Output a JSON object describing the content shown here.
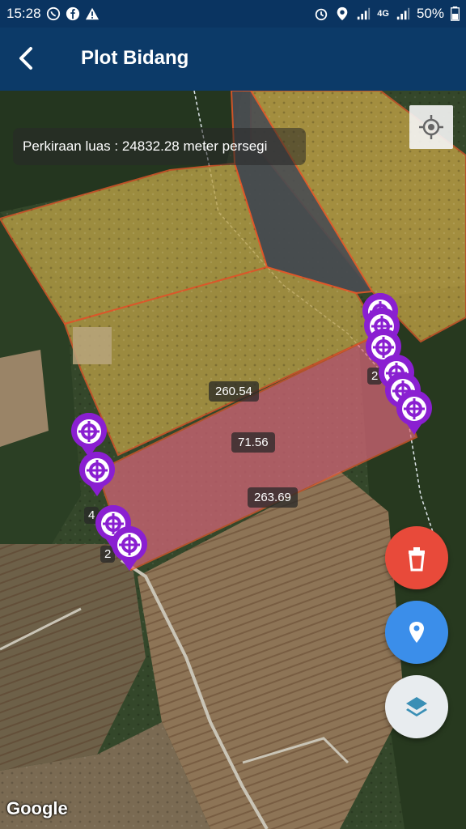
{
  "status_bar": {
    "time": "15:28",
    "network": "4G",
    "battery": "50%",
    "left_icons": [
      "whatsapp-icon",
      "facebook-icon",
      "warning-icon"
    ],
    "right_icons": [
      "alarm-icon",
      "location-icon",
      "signal-icon",
      "signal-icon",
      "battery-icon"
    ]
  },
  "app_bar": {
    "title": "Plot Bidang",
    "back_icon": "arrow-back-icon"
  },
  "map": {
    "area_label": "Perkiraan luas : 24832.28 meter persegi",
    "segment_labels": [
      "260.54",
      "71.56",
      "263.69"
    ],
    "partial_labels": [
      "2",
      "4",
      "2"
    ],
    "google_logo": "Google",
    "plot_fill_color": "#d9667a",
    "parcel_fill_color": "#d4b24a",
    "marker_color": "#8a1fd1"
  },
  "actions": {
    "delete_icon": "trash-icon",
    "delete_color": "#e84a3a",
    "add_point_icon": "map-pin-icon",
    "add_point_color": "#3b8eea",
    "layers_icon": "layers-icon",
    "layers_color": "#e8ecef",
    "my_location_icon": "crosshair-icon"
  }
}
